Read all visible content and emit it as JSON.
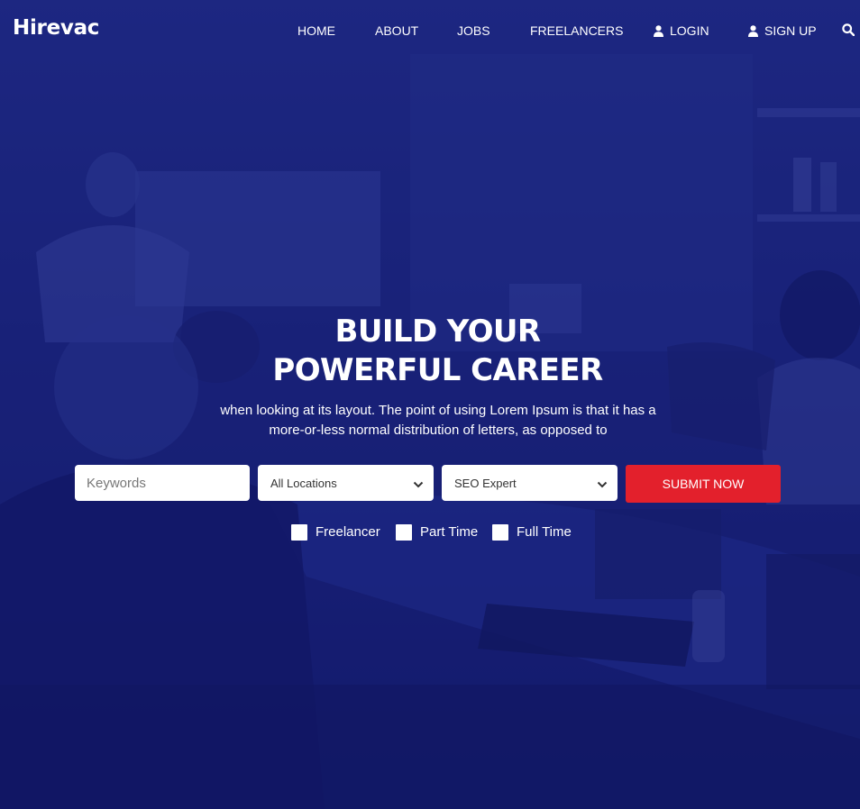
{
  "brand": {
    "name": "Hirevac"
  },
  "nav": {
    "items": [
      {
        "label": "HOME"
      },
      {
        "label": "ABOUT"
      },
      {
        "label": "JOBS"
      },
      {
        "label": "FREELANCERS"
      },
      {
        "label": "LOGIN",
        "icon": "user-icon"
      },
      {
        "label": "SIGN UP",
        "icon": "user-icon"
      }
    ],
    "search_icon": "search-icon"
  },
  "hero": {
    "title_line1": "BUILD YOUR",
    "title_line2": "POWERFUL CAREER",
    "subtitle": "when looking at its layout. The point of using Lorem Ipsum is that it has a more-or-less normal distribution of letters, as opposed to"
  },
  "search": {
    "keywords_placeholder": "Keywords",
    "keywords_value": "",
    "location_selected": "All Locations",
    "category_selected": "SEO Expert",
    "submit_label": "SUBMIT NOW"
  },
  "filters": [
    {
      "label": "Freelancer",
      "checked": false
    },
    {
      "label": "Part Time",
      "checked": false
    },
    {
      "label": "Full Time",
      "checked": false
    }
  ],
  "colors": {
    "overlay": "#121a66",
    "accent": "#e3202c",
    "text": "#ffffff"
  }
}
